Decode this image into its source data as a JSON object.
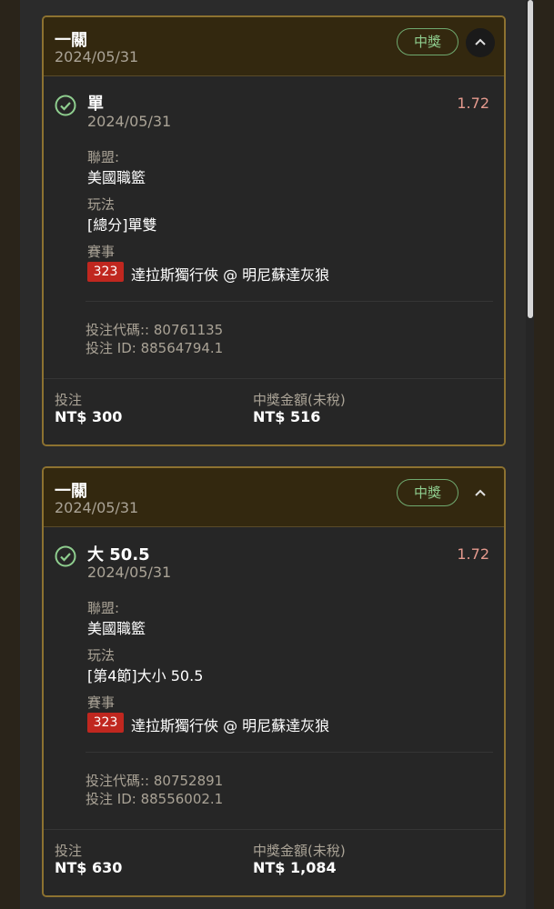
{
  "bets": [
    {
      "header": {
        "title": "一關",
        "date": "2024/05/31",
        "badge": "中獎"
      },
      "selection": {
        "title": "單",
        "date": "2024/05/31",
        "odds": "1.72"
      },
      "league": {
        "label": "聯盟:",
        "value": "美國職籃"
      },
      "market": {
        "label": "玩法",
        "value": "[總分]單雙"
      },
      "event": {
        "label": "賽事",
        "number": "323",
        "name": "達拉斯獨行俠 @ 明尼蘇達灰狼"
      },
      "codes": {
        "bet_code": "投注代碼:: 80761135",
        "bet_id": "投注 ID: 88564794.1"
      },
      "footer": {
        "stake_label": "投注",
        "stake_value": "NT$ 300",
        "payout_label": "中獎金額(未稅)",
        "payout_value": "NT$ 516"
      }
    },
    {
      "header": {
        "title": "一關",
        "date": "2024/05/31",
        "badge": "中獎"
      },
      "selection": {
        "title": "大 50.5",
        "date": "2024/05/31",
        "odds": "1.72"
      },
      "league": {
        "label": "聯盟:",
        "value": "美國職籃"
      },
      "market": {
        "label": "玩法",
        "value": "[第4節]大小 50.5"
      },
      "event": {
        "label": "賽事",
        "number": "323",
        "name": "達拉斯獨行俠 @ 明尼蘇達灰狼"
      },
      "codes": {
        "bet_code": "投注代碼:: 80752891",
        "bet_id": "投注 ID: 88556002.1"
      },
      "footer": {
        "stake_label": "投注",
        "stake_value": "NT$ 630",
        "payout_label": "中獎金額(未稅)",
        "payout_value": "NT$ 1,084"
      }
    }
  ],
  "colors": {
    "accent_gold": "#8d7230",
    "win_green": "#8fce8f",
    "odds_red": "#e59a8e",
    "match_red": "#c0271f"
  },
  "icons": {
    "status": "check-circle-icon",
    "collapse": "chevron-up-icon"
  }
}
